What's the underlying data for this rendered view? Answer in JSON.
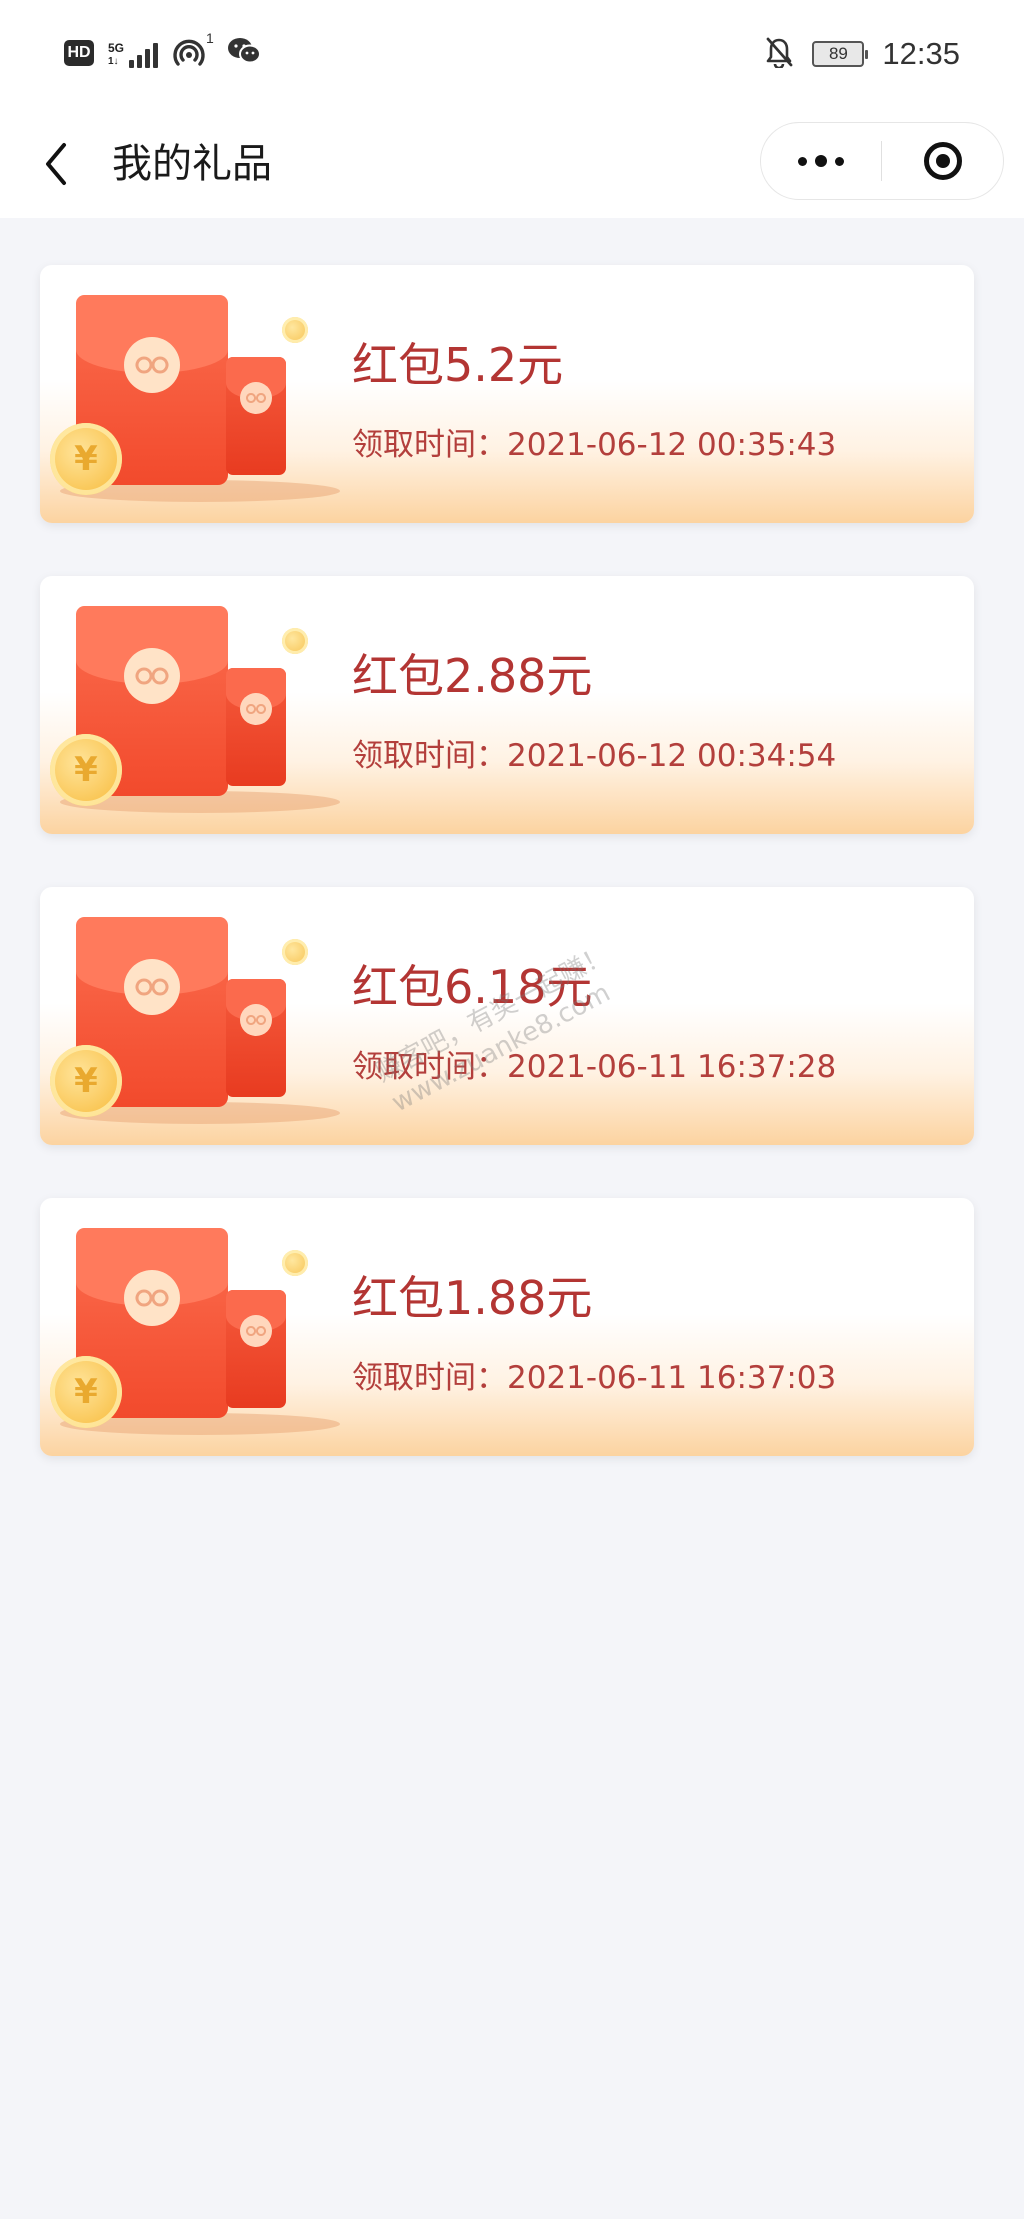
{
  "status_bar": {
    "hd": "HD",
    "network": "5G",
    "hotspot_sup": "1",
    "battery": "89",
    "time": "12:35",
    "icons": [
      "signal-icon",
      "hotspot-icon",
      "wechat-icon",
      "mute-bell-icon",
      "battery-icon"
    ]
  },
  "nav": {
    "title": "我的礼品",
    "back_icon": "chevron-left-icon",
    "more_icon": "more-dots-icon",
    "close_icon": "target-ring-icon"
  },
  "gifts": [
    {
      "title": "红包5.2元",
      "time": "领取时间：2021-06-12 00:35:43"
    },
    {
      "title": "红包2.88元",
      "time": "领取时间：2021-06-12 00:34:54"
    },
    {
      "title": "红包6.18元",
      "time": "领取时间：2021-06-11 16:37:28"
    },
    {
      "title": "红包1.88元",
      "time": "领取时间：2021-06-11 16:37:03"
    }
  ],
  "watermark": {
    "line1": "赚客吧，有奖一起赚！",
    "line2": "www.zuanke8.com"
  },
  "colors": {
    "page_bg": "#f4f5f9",
    "title_red": "#b33533",
    "envelope_red": "#f24a2c",
    "coin_gold": "#f9c34e",
    "card_gradient_end": "#fcd3a0"
  }
}
